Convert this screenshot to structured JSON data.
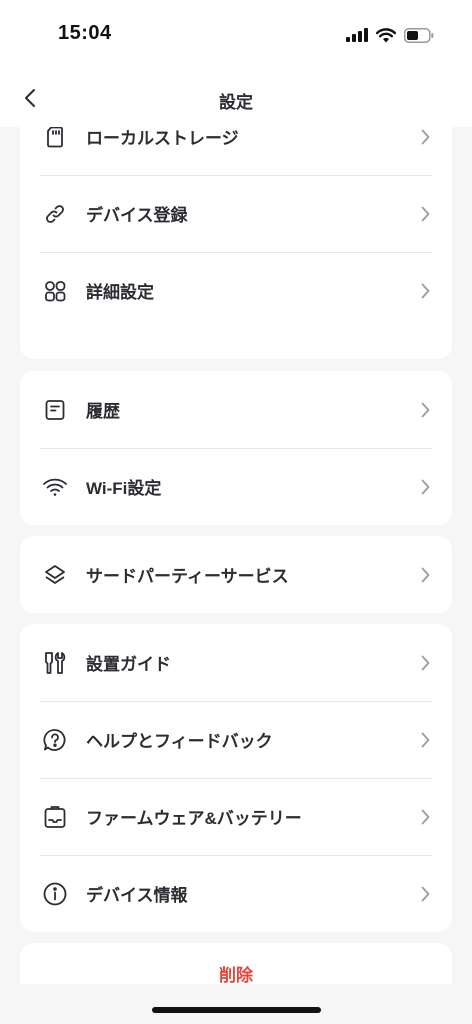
{
  "status_bar": {
    "time": "15:04"
  },
  "header": {
    "title": "設定"
  },
  "groups": [
    {
      "items": [
        {
          "label": "ローカルストレージ",
          "icon": "sd-card-icon"
        },
        {
          "label": "デバイス登録",
          "icon": "link-icon"
        },
        {
          "label": "詳細設定",
          "icon": "grid-icon"
        }
      ]
    },
    {
      "items": [
        {
          "label": "履歴",
          "icon": "document-icon"
        },
        {
          "label": "Wi-Fi設定",
          "icon": "wifi-icon"
        }
      ]
    },
    {
      "items": [
        {
          "label": "サードパーティーサービス",
          "icon": "layers-icon"
        }
      ]
    },
    {
      "items": [
        {
          "label": "設置ガイド",
          "icon": "tools-icon"
        },
        {
          "label": "ヘルプとフィードバック",
          "icon": "help-icon"
        },
        {
          "label": "ファームウェア&バッテリー",
          "icon": "firmware-icon"
        },
        {
          "label": "デバイス情報",
          "icon": "info-icon"
        }
      ]
    }
  ],
  "delete": {
    "label": "削除",
    "color": "#e5453a"
  },
  "colors": {
    "background": "#f6f6f6",
    "card": "#ffffff",
    "text": "#2b2d33",
    "chevron": "#9a9ca3"
  }
}
